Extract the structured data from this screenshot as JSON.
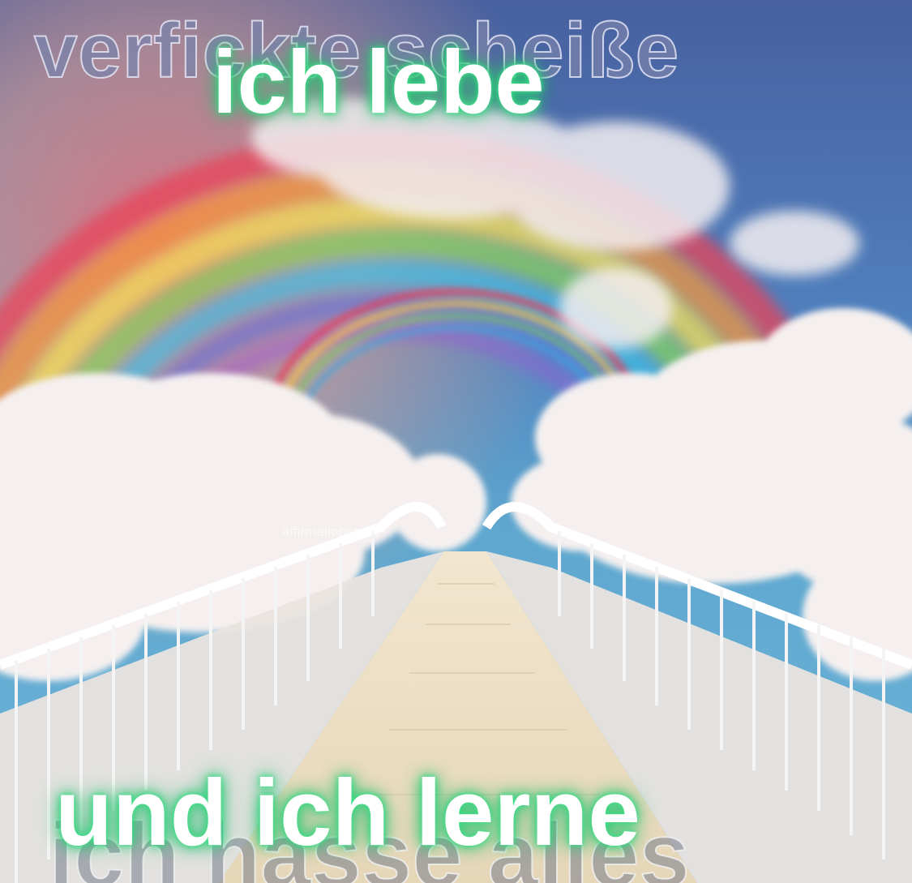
{
  "background_caption_top": "verfickte scheiße",
  "main_caption_top": "ich lebe",
  "main_caption_bottom": "und ich lerne",
  "background_caption_bottom": "ich hasse alles",
  "watermark": "affirmationen.de",
  "colors": {
    "caption_glow": "#2fd07a",
    "sky_top": "#4f6fb0",
    "sky_mid": "#5aa0d0",
    "cloud": "#f4f0ee"
  }
}
